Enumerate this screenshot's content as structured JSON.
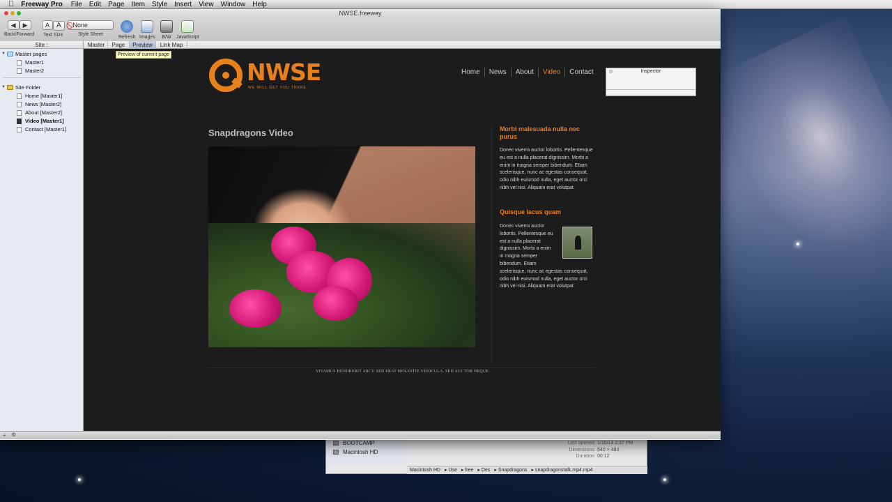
{
  "menubar": {
    "app_name": "Freeway Pro",
    "items": [
      "File",
      "Edit",
      "Page",
      "Item",
      "Style",
      "Insert",
      "View",
      "Window",
      "Help"
    ]
  },
  "window": {
    "title": "NWSE.freeway",
    "toolbar": {
      "back_forward": "Back/Forward",
      "text_size": "Text Size",
      "text_size_small": "A",
      "text_size_large": "A",
      "style_sheet_value": "None",
      "style_sheet": "Style Sheet",
      "refresh": "Refresh",
      "images": "Images",
      "bw": "B/W",
      "javascript": "JavaScript"
    },
    "site_header": "Site :",
    "tabs": [
      "Master",
      "Page",
      "Preview",
      "Link Map"
    ],
    "tooltip": "Preview of current page"
  },
  "sidebar": {
    "master_pages": "Master pages",
    "masters": [
      "Master1",
      "Master2"
    ],
    "site_folder": "Site Folder",
    "pages": [
      "Home [Master1]",
      "News [Master2]",
      "About [Master2]",
      "Video [Master1]",
      "Contact [Master1]"
    ],
    "selected_page": "Video [Master1]"
  },
  "site": {
    "logo_text": "NWSE",
    "tagline": "WE WILL GET YOU THERE",
    "nav": [
      "Home",
      "News",
      "About",
      "Video",
      "Contact"
    ],
    "active_nav": "Video",
    "page_title": "Snapdragons Video",
    "sidebar_heading1": "Morbi malesuada nulla nec purus",
    "sidebar_text1": "Donec viverra auctor lobortis. Pellentesque eu est a nulla placerat dignissim. Morbi a enim in magna semper bibendum. Etiam scelerisque, nunc ac egestas consequat, odio nibh euismod nulla, eget auctor orci nibh vel nisi. Aliquam erat volutpat.",
    "sidebar_heading2": "Quisque lacus quam",
    "sidebar_text2_lines": [
      "Donec viverra auctor",
      "lobortis. Pellentesque eu",
      "est a nulla placerat",
      "dignissim. Morbi a enim",
      "in magna semper",
      "bibendum. Etiam",
      "scelerisque, nunc ac egestas consequat,",
      "odio nibh euismod nulla, eget auctor orci",
      "nibh vel nisi. Aliquam erat volutpat."
    ],
    "footer": "VIVAMUS HENDRERIT ARCU SED ERAT MOLESTIE VEHICULA. SED AUCTOR NEQUE."
  },
  "inspector": {
    "title": "Inspector"
  },
  "finder": {
    "drives": [
      "BOOTCAMP",
      "Macintosh HD"
    ],
    "meta": [
      {
        "k": "Last opened",
        "v": "1/10/13 2:37 PM"
      },
      {
        "k": "Dimensions",
        "v": "640 × 480"
      },
      {
        "k": "Duration",
        "v": "00:12"
      }
    ],
    "path": [
      "Macintosh HD",
      "Use",
      "free",
      "Des",
      "Snapdragons",
      "snapdragonstalk.mp4.mp4"
    ]
  },
  "colors": {
    "accent": "#e8801e",
    "canvas_bg": "#1c1c1d"
  }
}
